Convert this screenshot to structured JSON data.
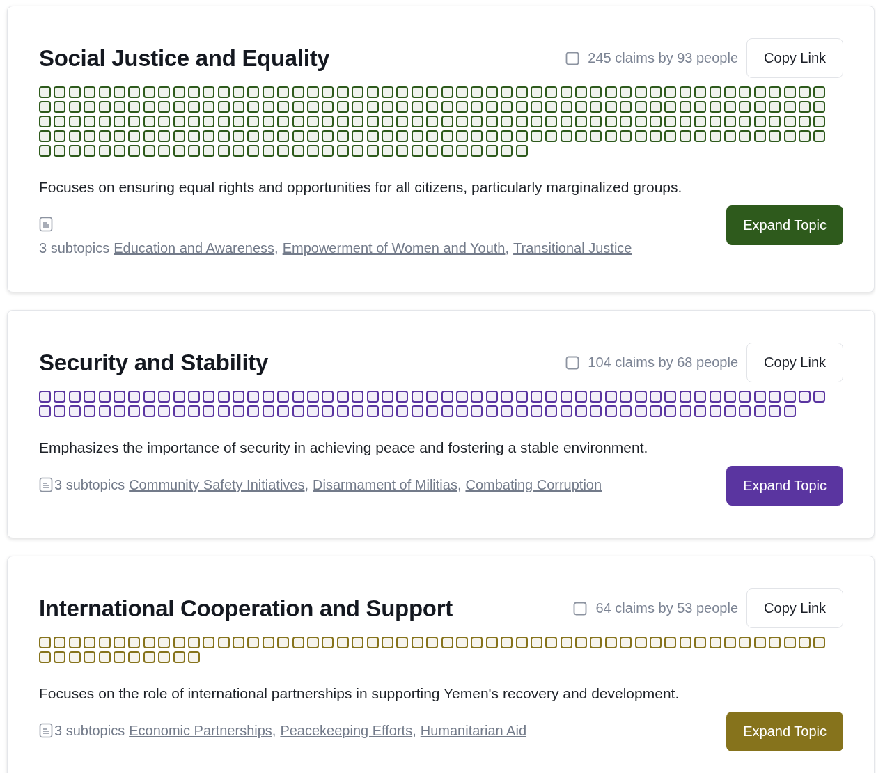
{
  "separator": ",",
  "topics": [
    {
      "title": "Social Justice and Equality",
      "claims": "245 claims by 93 people",
      "copy_button": "Copy Link",
      "color": "#2e5a1c",
      "description": "Focuses on ensuring equal rights and opportunities for all citizens, particularly marginalized groups.",
      "subtopic_count": "3 subtopics",
      "subtopics": [
        "Education and Awareness",
        "Empowerment of Women and Youth",
        "Transitional Justice"
      ],
      "expand_button": "Expand Topic"
    },
    {
      "title": "Security and Stability",
      "claims": "104 claims by 68 people",
      "copy_button": "Copy Link",
      "color": "#5a35a0",
      "description": "Emphasizes the importance of security in achieving peace and fostering a stable environment.",
      "subtopic_count": "3 subtopics",
      "subtopics": [
        "Community Safety Initiatives",
        "Disarmament of Militias",
        "Combating Corruption"
      ],
      "expand_button": "Expand Topic"
    },
    {
      "title": "International Cooperation and Support",
      "claims": "64 claims by 53 people",
      "copy_button": "Copy Link",
      "color": "#86731c",
      "description": "Focuses on the role of international partnerships in supporting Yemen's recovery and development.",
      "subtopic_count": "3 subtopics",
      "subtopics": [
        "Economic Partnerships",
        "Peacekeeping Efforts",
        "Humanitarian Aid"
      ],
      "expand_button": "Expand Topic"
    }
  ]
}
